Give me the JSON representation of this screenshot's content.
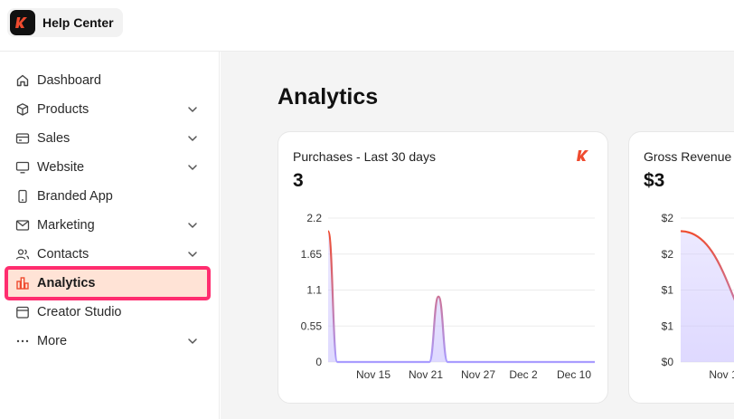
{
  "header": {
    "brand_label": "Help Center"
  },
  "sidebar": {
    "items": [
      {
        "label": "Dashboard",
        "icon": "home-icon",
        "expandable": false
      },
      {
        "label": "Products",
        "icon": "box-icon",
        "expandable": true
      },
      {
        "label": "Sales",
        "icon": "credit-card-icon",
        "expandable": true
      },
      {
        "label": "Website",
        "icon": "monitor-icon",
        "expandable": true
      },
      {
        "label": "Branded App",
        "icon": "phone-icon",
        "expandable": false
      },
      {
        "label": "Marketing",
        "icon": "mail-icon",
        "expandable": true
      },
      {
        "label": "Contacts",
        "icon": "users-icon",
        "expandable": true
      },
      {
        "label": "Analytics",
        "icon": "bar-chart-icon",
        "expandable": false,
        "active": true
      },
      {
        "label": "Creator Studio",
        "icon": "calendar-icon",
        "expandable": false
      },
      {
        "label": "More",
        "icon": "ellipsis-icon",
        "expandable": true
      }
    ]
  },
  "main": {
    "title": "Analytics"
  },
  "cards": [
    {
      "title": "Purchases - Last 30 days",
      "value": "3"
    },
    {
      "title": "Gross Revenue",
      "value": "$3"
    }
  ],
  "colors": {
    "accent": "#ef4b2f",
    "highlight_bg": "#ffe3d6",
    "highlight_border": "#ff2d6f",
    "line_bottom": "#a99cff"
  },
  "chart_data": [
    {
      "type": "area",
      "title": "Purchases - Last 30 days",
      "x_tick_labels": [
        "Nov 15",
        "Nov 21",
        "Nov 27",
        "Dec 2",
        "Dec 10"
      ],
      "y_tick_labels": [
        "2.2",
        "1.65",
        "1.1",
        "0.55",
        "0"
      ],
      "ylim": [
        0,
        2.2
      ],
      "series": [
        {
          "y": [
            2,
            0,
            0,
            0,
            0,
            0,
            0,
            0,
            0,
            0,
            0,
            0,
            1,
            0,
            0,
            0,
            0,
            0,
            0,
            0,
            0,
            0,
            0,
            0,
            0,
            0,
            0,
            0,
            0,
            0
          ]
        }
      ],
      "grid": true
    },
    {
      "type": "area",
      "title": "Gross Revenue",
      "x_tick_labels": [
        "Nov 1"
      ],
      "y_tick_labels": [
        "$2",
        "$2",
        "$1",
        "$1",
        "$0"
      ],
      "ylim": [
        0,
        2.2
      ],
      "series": [
        {
          "y": [
            2,
            0,
            0,
            0,
            0,
            0
          ]
        }
      ],
      "grid": true
    }
  ]
}
